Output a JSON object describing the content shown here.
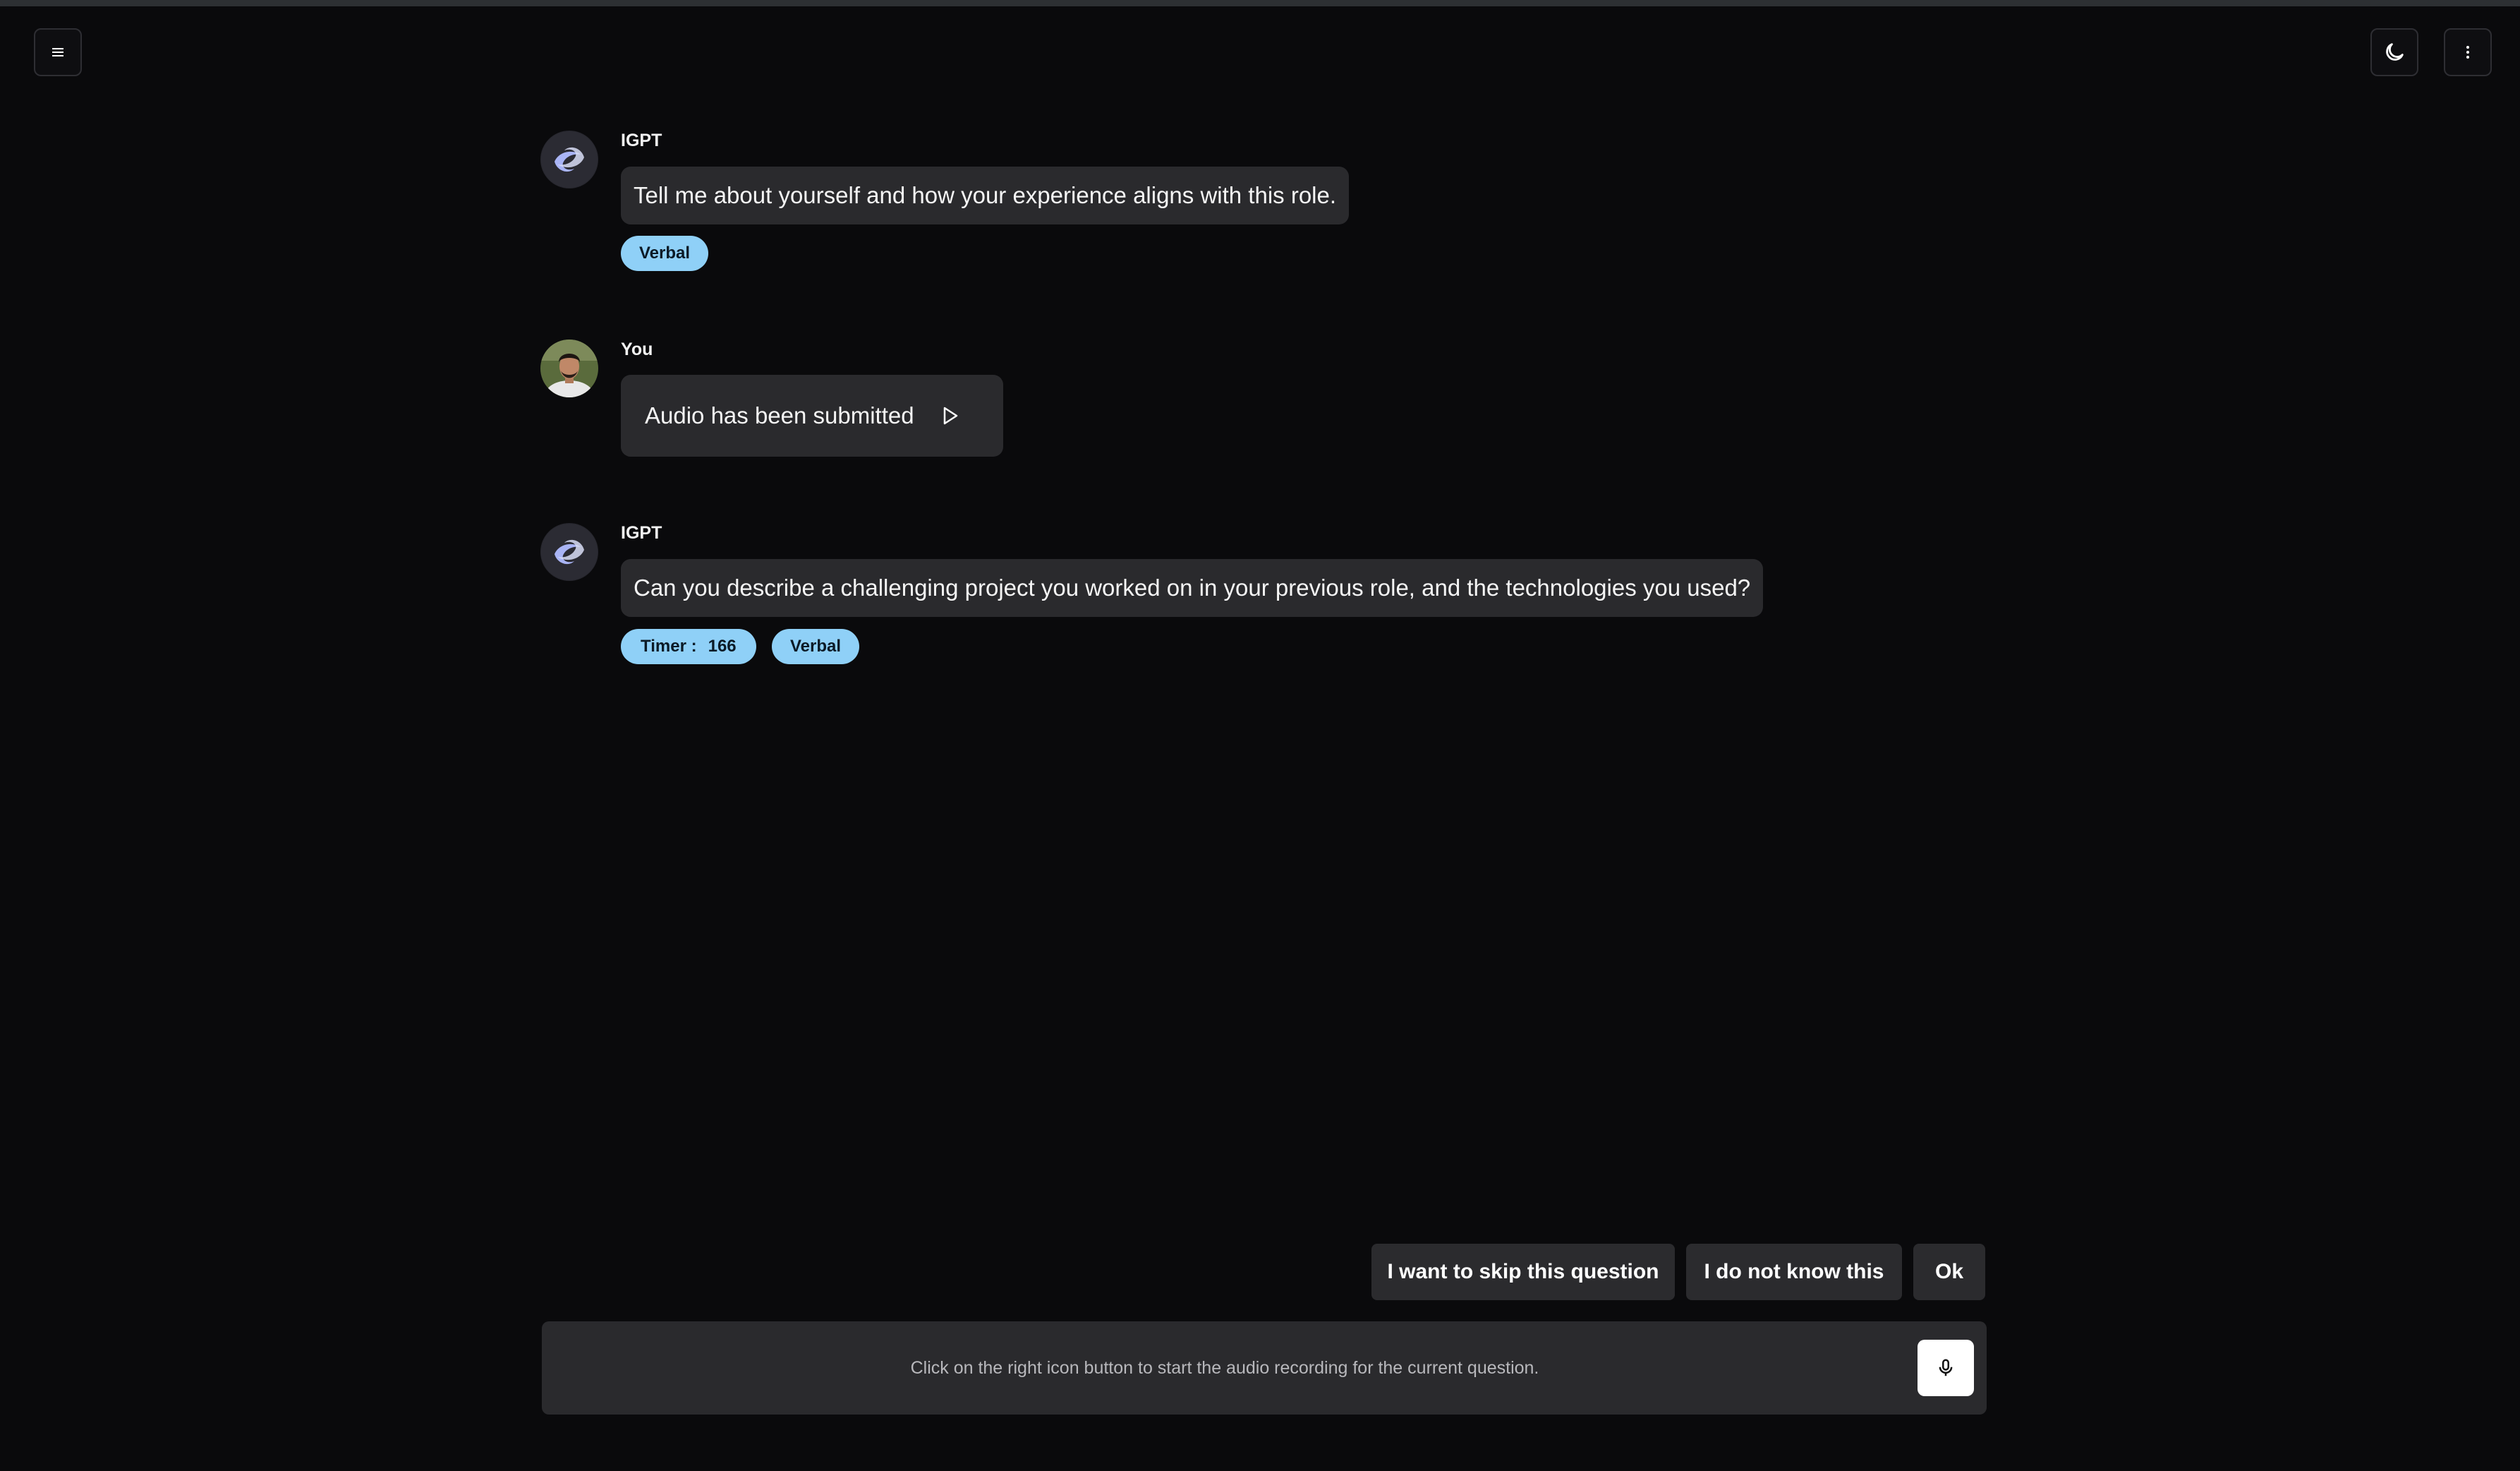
{
  "header": {
    "menu_icon": "hamburger-menu-icon",
    "theme_icon": "moon-icon",
    "more_icon": "vertical-dots-icon"
  },
  "messages": [
    {
      "sender": "IGPT",
      "text": "Tell me about yourself and how your experience aligns with this role.",
      "tags": [
        "Verbal"
      ]
    },
    {
      "sender": "You",
      "text": "Audio has been submitted",
      "play_icon": "play-icon"
    },
    {
      "sender": "IGPT",
      "text": "Can you describe a challenging project you worked on in your previous role, and the technologies you used?",
      "timer_label": "Timer :",
      "timer_value": "166",
      "tags": [
        "Verbal"
      ]
    }
  ],
  "actions": {
    "skip": "I want to skip this question",
    "dont_know": "I do not know this",
    "ok": "Ok"
  },
  "input": {
    "hint": "Click on the right icon button to start the audio recording for the current question.",
    "mic_icon": "microphone-icon"
  },
  "colors": {
    "background": "#0a0a0c",
    "bubble": "#2a2a2d",
    "tag": "#8fd0f7"
  }
}
